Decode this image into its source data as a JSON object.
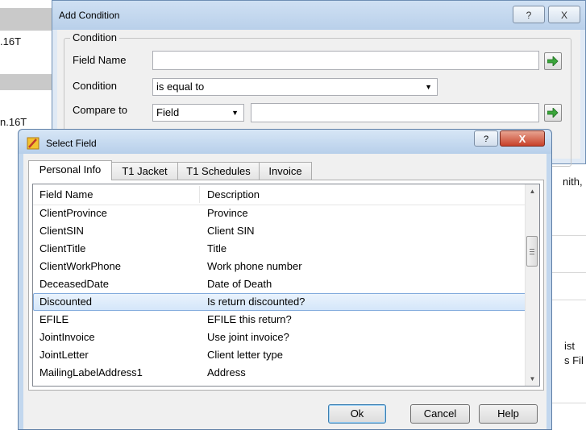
{
  "background": {
    "fragments": [
      ".16T",
      "n.16T",
      "nith,",
      "ist",
      "s Fil"
    ]
  },
  "add_condition": {
    "title": "Add Condition",
    "help_glyph": "?",
    "close_glyph": "X",
    "group_label": "Condition",
    "field_name_label": "Field Name",
    "field_name_value": "",
    "condition_label": "Condition",
    "condition_value": "is equal to",
    "compare_to_label": "Compare to",
    "compare_to_value": "Field",
    "compare_value": ""
  },
  "select_field": {
    "title": "Select Field",
    "help_glyph": "?",
    "close_glyph": "X",
    "tabs": [
      {
        "label": "Personal Info",
        "active": true
      },
      {
        "label": "T1 Jacket",
        "active": false
      },
      {
        "label": "T1 Schedules",
        "active": false
      },
      {
        "label": "Invoice",
        "active": false
      }
    ],
    "columns": {
      "field_name": "Field Name",
      "description": "Description"
    },
    "rows": [
      {
        "field": "ClientProvince",
        "description": "Province"
      },
      {
        "field": "ClientSIN",
        "description": "Client SIN"
      },
      {
        "field": "ClientTitle",
        "description": "Title"
      },
      {
        "field": "ClientWorkPhone",
        "description": "Work phone number"
      },
      {
        "field": "DeceasedDate",
        "description": "Date of Death"
      },
      {
        "field": "Discounted",
        "description": "Is return discounted?"
      },
      {
        "field": "EFILE",
        "description": "EFILE this return?"
      },
      {
        "field": "JointInvoice",
        "description": "Use joint invoice?"
      },
      {
        "field": "JointLetter",
        "description": "Client letter type"
      },
      {
        "field": "MailingLabelAddress1",
        "description": "Address"
      }
    ],
    "selected_row": 5,
    "buttons": {
      "ok": "Ok",
      "cancel": "Cancel",
      "help": "Help"
    }
  },
  "colors": {
    "selection": "#d4e6fa",
    "close_button": "#c8412a",
    "go_arrow": "#3aa53a"
  }
}
